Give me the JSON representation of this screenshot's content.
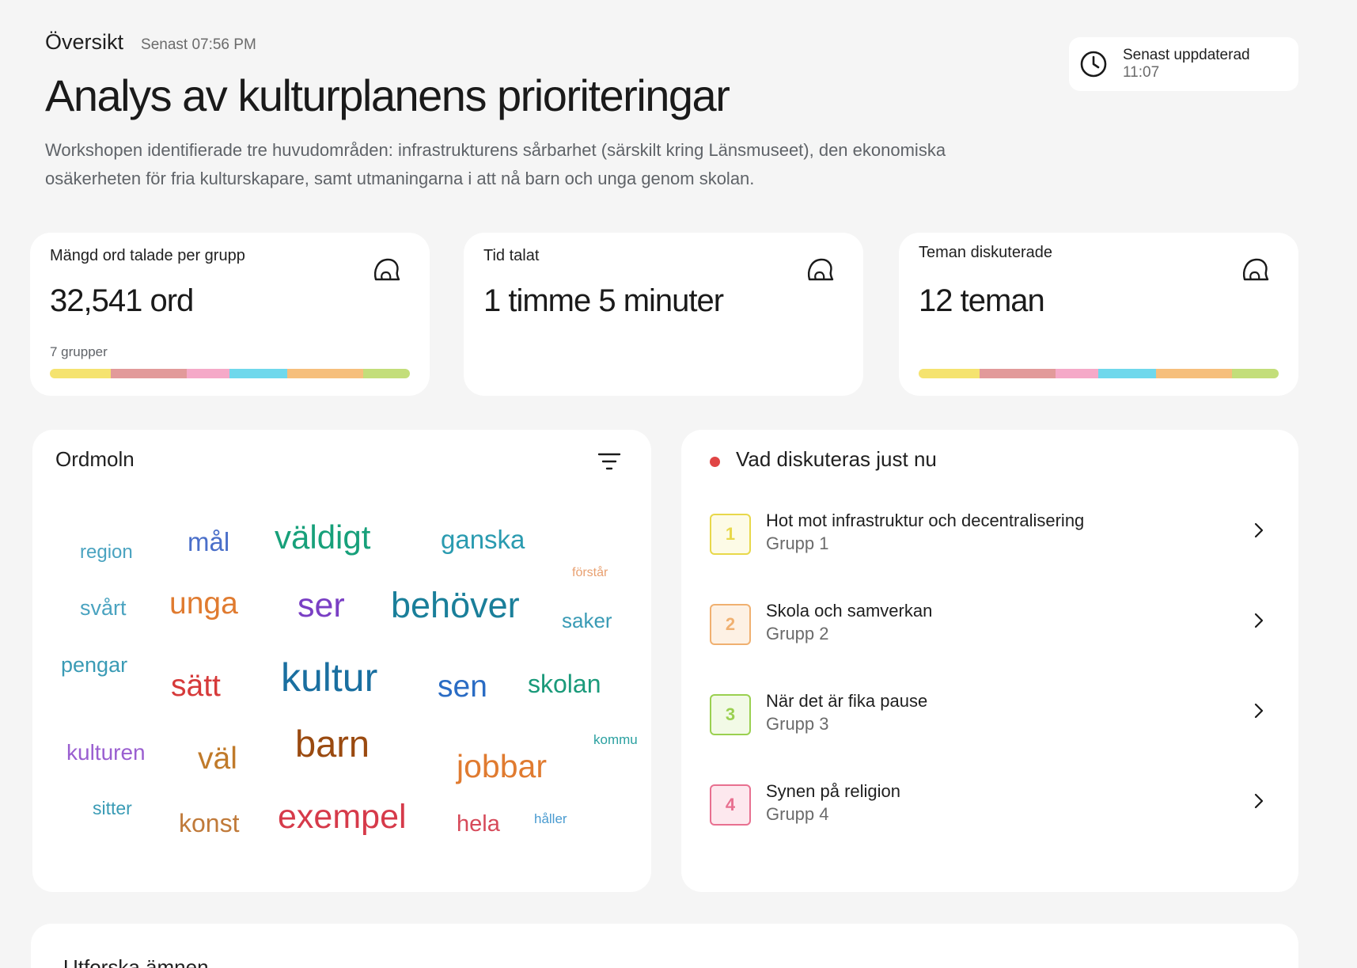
{
  "header": {
    "section": "Översikt",
    "last_time": "Senast 07:56 PM",
    "title": "Analys av kulturplanens prioriteringar",
    "description": "Workshopen identifierade tre huvudområden: infrastrukturens sårbarhet (särskilt kring Länsmuseet), den ekonomiska osäkerheten för fria kulturskapare, samt utmaningarna i att nå barn och unga genom skolan."
  },
  "updated": {
    "label": "Senast uppdaterad",
    "time": "11:07",
    "icon": "clock-icon"
  },
  "group_colors": [
    "#f5e36f",
    "#e29a9a",
    "#f5a9c8",
    "#6fd8ec",
    "#f6bf7c",
    "#c3de7a"
  ],
  "stats": {
    "words": {
      "label": "Mängd ord talade per grupp",
      "value": "32,541 ord",
      "sub": "7 grupper",
      "icon": "head-icon"
    },
    "time": {
      "label": "Tid talat",
      "value": "1 timme 5 minuter",
      "icon": "head-icon"
    },
    "themes": {
      "label": "Teman diskuterade",
      "value": "12 teman",
      "icon": "head-icon"
    }
  },
  "word_cloud": {
    "title": "Ordmoln",
    "filter_icon": "filter-icon",
    "words": [
      {
        "text": "region",
        "color": "#4aa3c0"
      },
      {
        "text": "mål",
        "color": "#4a6fc9"
      },
      {
        "text": "väldigt",
        "color": "#17a07a"
      },
      {
        "text": "ganska",
        "color": "#2a9bb0"
      },
      {
        "text": "förstår",
        "color": "#e8a070"
      },
      {
        "text": "svårt",
        "color": "#4aa3c0"
      },
      {
        "text": "unga",
        "color": "#e07b30"
      },
      {
        "text": "ser",
        "color": "#7a3fc4"
      },
      {
        "text": "behöver",
        "color": "#1a7f9a"
      },
      {
        "text": "saker",
        "color": "#3a9bb5"
      },
      {
        "text": "pengar",
        "color": "#3a9bb5"
      },
      {
        "text": "sätt",
        "color": "#d63a3a"
      },
      {
        "text": "kultur",
        "color": "#1a6fa0"
      },
      {
        "text": "sen",
        "color": "#2a6cc4"
      },
      {
        "text": "skolan",
        "color": "#1a9a7a"
      },
      {
        "text": "kommu",
        "color": "#2aa0a0"
      },
      {
        "text": "kulturen",
        "color": "#9a5fd0"
      },
      {
        "text": "väl",
        "color": "#c07a2a"
      },
      {
        "text": "barn",
        "color": "#9a4a10"
      },
      {
        "text": "jobbar",
        "color": "#e07b30"
      },
      {
        "text": "sitter",
        "color": "#3a9bb5"
      },
      {
        "text": "konst",
        "color": "#c07a3a"
      },
      {
        "text": "exempel",
        "color": "#d63a4a"
      },
      {
        "text": "hela",
        "color": "#d64a5a"
      },
      {
        "text": "håller",
        "color": "#4a9bd0"
      }
    ]
  },
  "discussing": {
    "title": "Vad diskuteras just nu",
    "topics": [
      {
        "num": "1",
        "title": "Hot mot infrastruktur och decentralisering",
        "group": "Grupp 1",
        "color": "#e8d84a",
        "bg": "#fdfbe6"
      },
      {
        "num": "2",
        "title": "Skola och samverkan",
        "group": "Grupp 2",
        "color": "#f0b070",
        "bg": "#fdf1e4"
      },
      {
        "num": "3",
        "title": "När det är fika pause",
        "group": "Grupp 3",
        "color": "#9ad050",
        "bg": "#f2fae6"
      },
      {
        "num": "4",
        "title": "Synen på religion",
        "group": "Grupp 4",
        "color": "#e87090",
        "bg": "#fde8ee"
      }
    ]
  },
  "explore": {
    "title": "Utforska ämnen"
  }
}
